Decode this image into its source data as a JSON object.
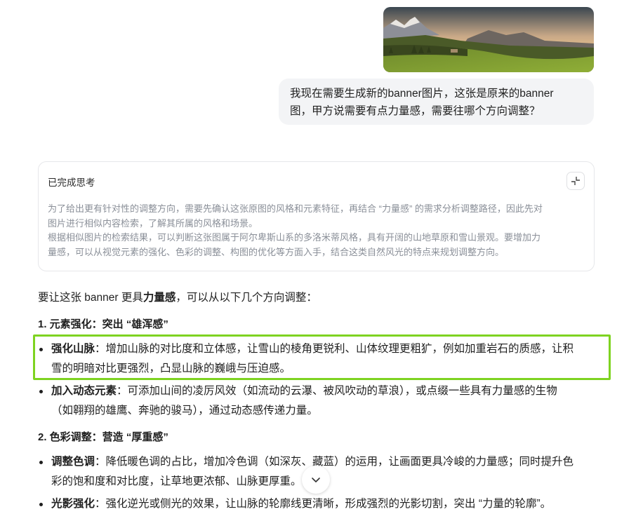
{
  "user_image": {
    "description_icon": "mountain-landscape-image"
  },
  "user_message": {
    "line1": "我现在需要生成新的banner图片，这张是原来的banner",
    "line2": "图，甲方说需要有点力量感，需要往哪个方向调整？"
  },
  "thinking": {
    "title": "已完成思考",
    "collapse_icon": "collapse-icon",
    "paragraph1_line1": "为了给出更有针对性的调整方向，需要先确认这张原图的风格和元素特征，再结合 “力量感” 的需求分析调整路径，因此先对",
    "paragraph1_line2": "图片进行相似内容检索，了解其所属的风格和场景。",
    "paragraph2_line1": "根据相似图片的检索结果，可以判断这张图属于阿尔卑斯山系的多洛米蒂风格，具有开阔的山地草原和雪山景观。要增加力",
    "paragraph2_line2": "量感，可以从视觉元素的强化、色彩的调整、构图的优化等方面入手，结合这类自然风光的特点来规划调整方向。"
  },
  "answer": {
    "intro_prefix": "要让这张 banner 更具",
    "intro_bold": "力量感",
    "intro_suffix": "，可以从以下几个方向调整：",
    "section1_title": "1. 元素强化：突出 “雄浑感”",
    "s1_b1_bold": "强化山脉",
    "s1_b1_line1": "：增加山脉的对比度和立体感，让雪山的棱角更锐利、山体纹理更粗犷，例如加重岩石的质感，让积",
    "s1_b1_line2": "雪的明暗对比更强烈，凸显山脉的巍峨与压迫感。",
    "s1_b2_bold": "加入动态元素",
    "s1_b2_line1": "：可添加山间的凌厉风效（如流动的云瀑、被风吹动的草浪），或点缀一些具有力量感的生物",
    "s1_b2_line2": "（如翱翔的雄鹰、奔驰的骏马），通过动态感传递力量。",
    "section2_title": "2. 色彩调整：营造 “厚重感”",
    "s2_b1_bold": "调整色调",
    "s2_b1_line1": "：降低暖色调的占比，增加冷色调（如深灰、藏蓝）的运用，让画面更具冷峻的力量感；同时提升色",
    "s2_b1_line2": "彩的饱和度和对比度，让草地更浓郁、山脉更厚重。",
    "s2_b2_bold": "光影强化",
    "s2_b2_line1": "：强化逆光或侧光的效果，让山脉的轮廓线更清晰，形成强烈的光影切割，突出 “力量的轮廓”。"
  },
  "scroll_button": {
    "icon": "chevron-down-icon"
  }
}
